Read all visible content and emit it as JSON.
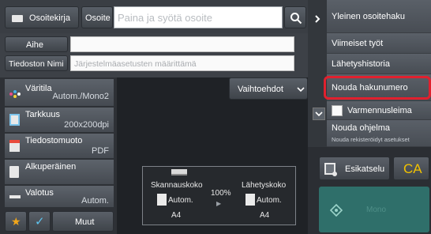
{
  "top": {
    "address_book_label": "Osoitekirja",
    "address_label": "Osoite",
    "address_placeholder": "Paina ja syötä osoite"
  },
  "fields": {
    "subject_label": "Aihe",
    "subject_value": "",
    "filename_label": "Tiedoston Nimi",
    "filename_placeholder": "Järjestelmäasetusten määrittämä"
  },
  "settings": [
    {
      "label": "Väritila",
      "value": "Autom./Mono2",
      "icon": "color-mode-icon"
    },
    {
      "label": "Tarkkuus",
      "value": "200x200dpi",
      "icon": "resolution-icon"
    },
    {
      "label": "Tiedostomuoto",
      "value": "PDF",
      "icon": "file-format-icon"
    },
    {
      "label": "Alkuperäinen",
      "value": "",
      "icon": "original-icon"
    },
    {
      "label": "Valotus",
      "value": "Autom.",
      "icon": "exposure-icon"
    }
  ],
  "bottom": {
    "others_label": "Muut"
  },
  "options_label": "Vaihtoehdot",
  "preview_panel": {
    "scan_size_label": "Skannauskoko",
    "scan_size_value": "Autom.",
    "scan_size_paper": "A4",
    "ratio": "100%",
    "send_size_label": "Lähetyskoko",
    "send_size_value": "Autom.",
    "send_size_paper": "A4"
  },
  "menu": {
    "items": [
      "Yleinen osoitehaku",
      "Viimeiset työt",
      "Lähetyshistoria",
      "Nouda hakunumero"
    ],
    "verification_stamp": "Varmennusleima",
    "retrieve_program": "Nouda ohjelma",
    "retrieve_sub": "Nouda rekisteröidyt asetukset"
  },
  "actions": {
    "preview_label": "Esikatselu",
    "ca_label": "CA",
    "start_label": "Mono"
  },
  "colors": {
    "highlight": "#e0202e",
    "accent_ca": "#f2c200",
    "start_green": "#2f6f6a"
  }
}
